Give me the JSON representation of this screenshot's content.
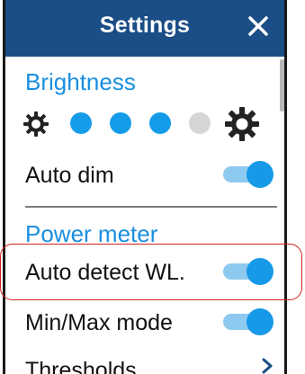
{
  "header": {
    "title": "Settings"
  },
  "brightness": {
    "section_title": "Brightness",
    "level": 3,
    "max_level": 4,
    "dot_colors": {
      "on": "#159ce8",
      "off": "#d6d6d6"
    }
  },
  "auto_dim": {
    "label": "Auto dim",
    "enabled": true
  },
  "power_meter": {
    "section_title": "Power meter"
  },
  "auto_detect_wl": {
    "label": "Auto detect WL.",
    "enabled": true
  },
  "min_max_mode": {
    "label": "Min/Max mode",
    "enabled": true
  },
  "thresholds": {
    "label": "Thresholds"
  },
  "colors": {
    "accent": "#1699e6",
    "header_bg": "#1b4d86",
    "highlight": "#d42020"
  }
}
